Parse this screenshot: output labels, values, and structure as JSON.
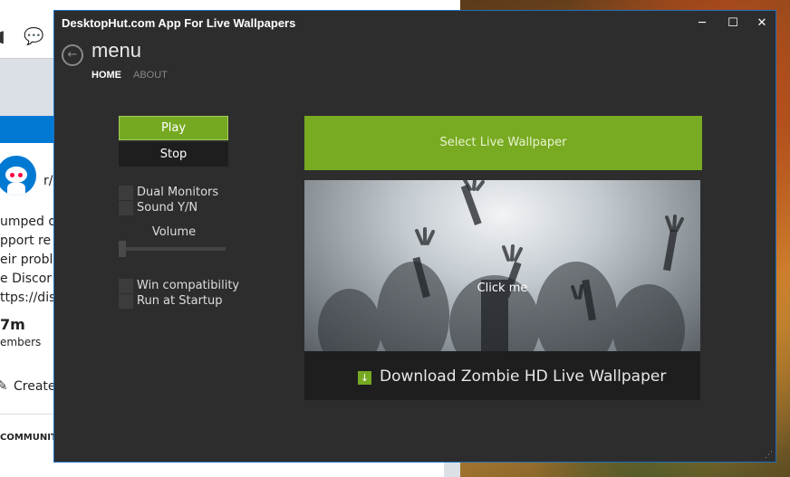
{
  "background_window": {
    "snippets": [
      "r/",
      "umped o",
      "pport re",
      "eir proble",
      "e Discor",
      "ttps://disc",
      "7m",
      "embers",
      "Create",
      "COMMUNIT"
    ]
  },
  "app": {
    "title": "DesktopHut.com App For Live Wallpapers",
    "window_controls": {
      "minimize": "─",
      "maximize": "☐",
      "close": "✕"
    },
    "back_glyph": "←",
    "menu_title": "menu",
    "tabs": [
      {
        "label": "HOME",
        "active": true
      },
      {
        "label": "ABOUT",
        "active": false
      }
    ],
    "controls": {
      "play_label": "Play",
      "stop_label": "Stop",
      "dual_monitors_label": "Dual Monitors",
      "sound_label": "Sound Y/N",
      "volume_label": "Volume",
      "volume_level": 0,
      "win_compat_label": "Win compatibility",
      "startup_label": "Run at Startup"
    },
    "select_wallpaper_label": "Select Live Wallpaper",
    "preview": {
      "overlay_text": "Click me",
      "download_glyph": "↓",
      "download_label": "Download Zombie HD Live Wallpaper"
    },
    "colors": {
      "accent": "#78aa22",
      "window_bg": "#2d2d2d",
      "border": "#1b6fbf"
    }
  }
}
